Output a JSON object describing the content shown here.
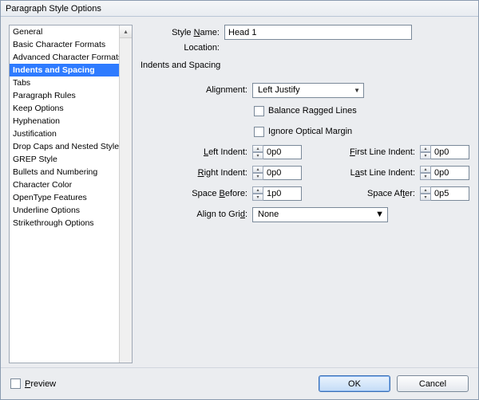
{
  "window_title": "Paragraph Style Options",
  "sidebar": {
    "selected_index": 3,
    "items": [
      "General",
      "Basic Character Formats",
      "Advanced Character Formats",
      "Indents and Spacing",
      "Tabs",
      "Paragraph Rules",
      "Keep Options",
      "Hyphenation",
      "Justification",
      "Drop Caps and Nested Styles",
      "GREP Style",
      "Bullets and Numbering",
      "Character Color",
      "OpenType Features",
      "Underline Options",
      "Strikethrough Options"
    ]
  },
  "header": {
    "style_name_label": "Style Name:",
    "style_name_value": "Head 1",
    "location_label": "Location:",
    "section_heading": "Indents and Spacing"
  },
  "form": {
    "alignment": {
      "label": "Alignment:",
      "value": "Left Justify"
    },
    "balance_ragged": {
      "label": "Balance Ragged Lines",
      "checked": false
    },
    "ignore_optical": {
      "label": "Ignore Optical Margin",
      "checked": false
    },
    "left_indent": {
      "label": "Left Indent:",
      "value": "0p0"
    },
    "first_line": {
      "label": "First Line Indent:",
      "value": "0p0"
    },
    "right_indent": {
      "label": "Right Indent:",
      "value": "0p0"
    },
    "last_line": {
      "label": "Last Line Indent:",
      "value": "0p0"
    },
    "space_before": {
      "label": "Space Before:",
      "value": "1p0"
    },
    "space_after": {
      "label": "Space After:",
      "value": "0p5"
    },
    "align_to_grid": {
      "label": "Align to Grid:",
      "value": "None"
    }
  },
  "footer": {
    "preview_label": "Preview",
    "preview_checked": false,
    "ok_label": "OK",
    "cancel_label": "Cancel"
  }
}
